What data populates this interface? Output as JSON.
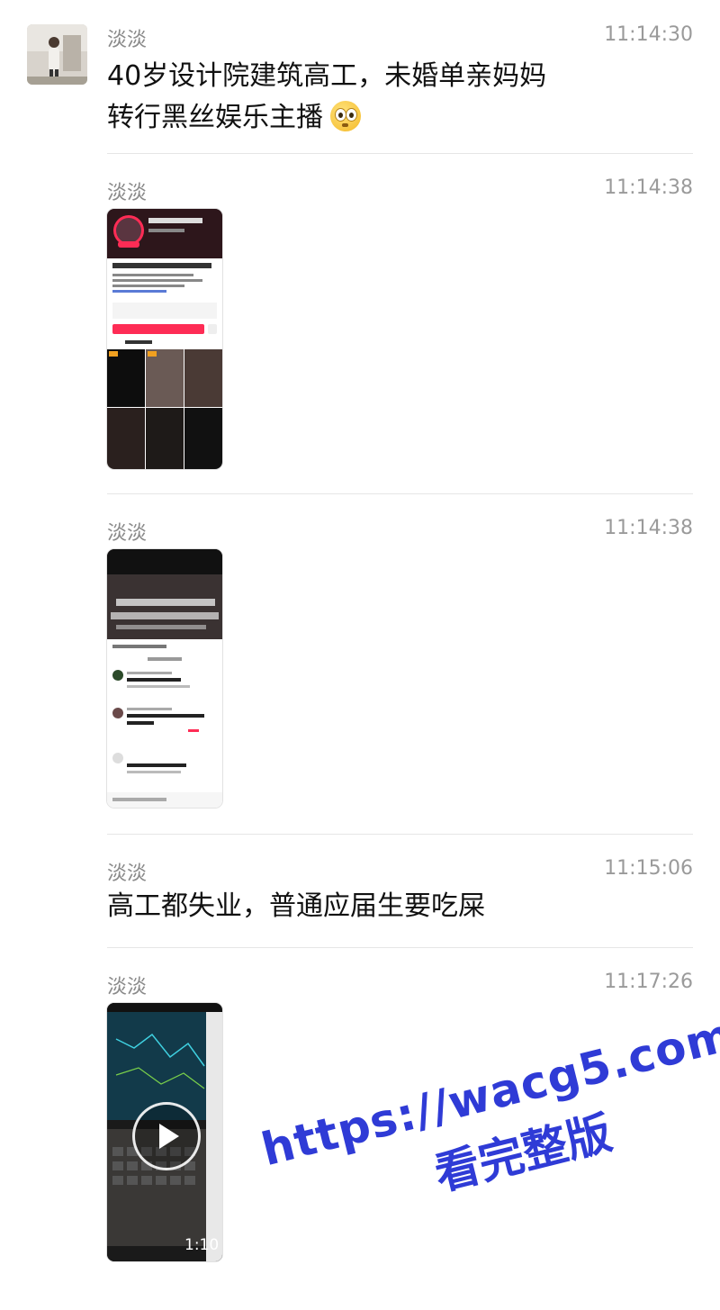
{
  "chat": {
    "messages": [
      {
        "sender": "淡淡",
        "time": "11:14:30",
        "text_line1": "40岁设计院建筑高工，未婚单亲妈妈",
        "text_line2": "转行黑丝娱乐主播"
      },
      {
        "sender": "淡淡",
        "time": "11:14:38",
        "thumb_desc": "profile-screenshot"
      },
      {
        "sender": "淡淡",
        "time": "11:14:38",
        "thumb_desc": "comment-screenshot"
      },
      {
        "sender": "淡淡",
        "time": "11:15:06",
        "text_line1": "高工都失业，普通应届生要吃屎"
      },
      {
        "sender": "淡淡",
        "time": "11:17:26",
        "video_duration": "1:10"
      }
    ]
  },
  "watermark": {
    "line1": "https://wacg5.com",
    "line2": "看完整版"
  },
  "colors": {
    "accent_pink": "#fe2c55",
    "watermark_blue": "#2f3bd6"
  }
}
